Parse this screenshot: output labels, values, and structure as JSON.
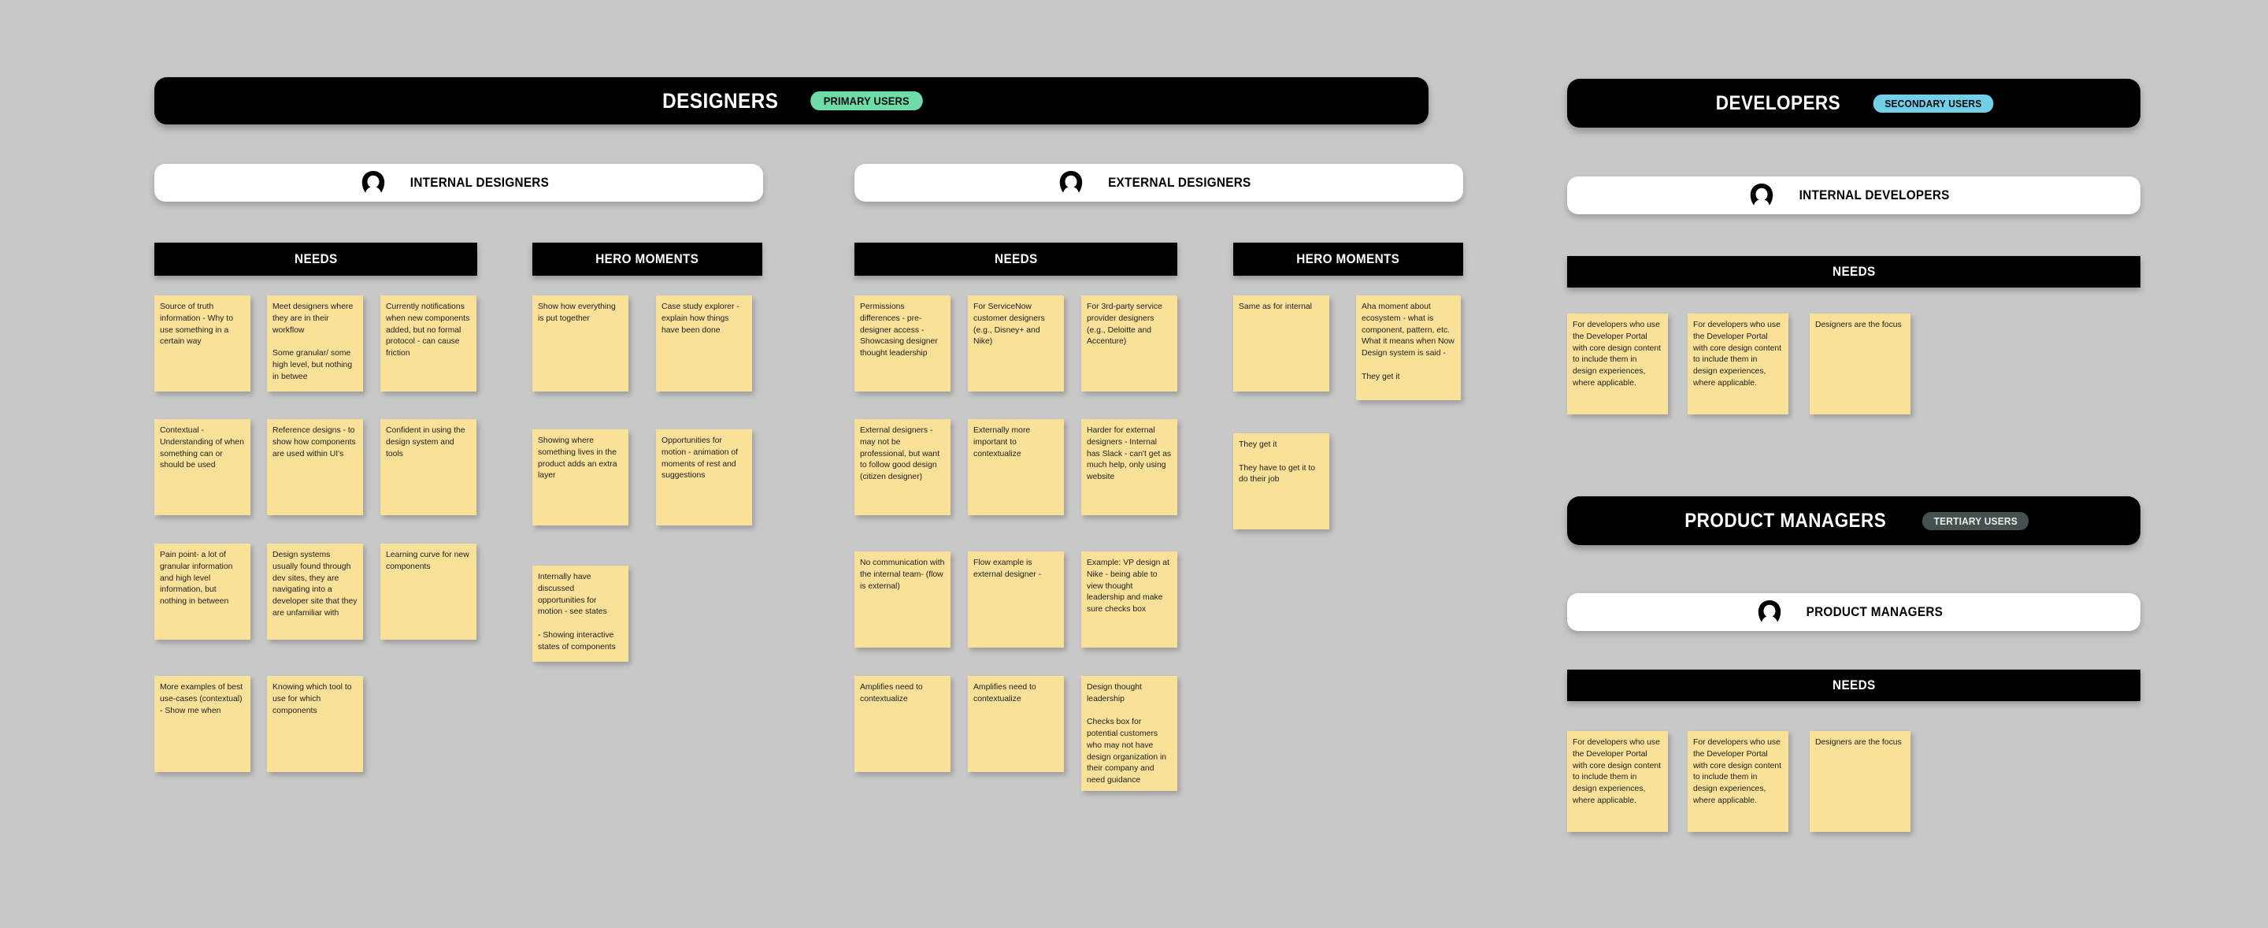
{
  "board": {
    "background_color": "#C8C8C8",
    "note_color": "#FAE199",
    "banner_color": "#000000"
  },
  "groups": [
    {
      "id": "designers",
      "title": "DESIGNERS",
      "badge": "PRIMARY USERS",
      "badge_color": "#6EDCA8"
    },
    {
      "id": "developers",
      "title": "DEVELOPERS",
      "badge": "SECONDARY USERS",
      "badge_color": "#72CFE5"
    },
    {
      "id": "product_managers",
      "title": "PRODUCT MANAGERS",
      "badge": "TERTIARY USERS",
      "badge_color": "#44514E"
    }
  ],
  "personas": {
    "internal_designers": "INTERNAL DESIGNERS",
    "external_designers": "EXTERNAL DESIGNERS",
    "internal_developers": "INTERNAL DEVELOPERS",
    "product_managers": "PRODUCT MANAGERS"
  },
  "column_headers": {
    "needs": "NEEDS",
    "hero_moments": "HERO MOMENTS"
  },
  "internal_designers": {
    "needs": [
      "Source of truth information - Why to use something in a certain way",
      "Meet designers where they are in their workflow\n\nSome granular/ some high level, but nothing in betwee",
      "Currently notifications when new components added, but no formal protocol - can cause friction",
      "Contextual - Understanding of when something can or should be used",
      "Reference designs - to show how components are used within UI's",
      "Confident in using the design system and tools",
      "Pain point- a lot of granular information and high level information, but nothing in between",
      "Design systems usually found through dev sites, they are navigating into a developer site that they are unfamiliar with",
      "Learning curve for new components",
      "More examples of best use-cases (contextual) - Show me when",
      "Knowing which tool to use for which components"
    ],
    "hero_moments": [
      "Show how everything is put together",
      "Case study explorer - explain how things have been done",
      "Showing where something lives in the product adds an extra layer",
      "Opportunities for motion - animation of moments of rest and suggestions",
      "Internally have discussed opportunities for motion - see states\n\n- Showing interactive states of components"
    ]
  },
  "external_designers": {
    "needs": [
      "Permissions differences - pre-designer access - Showcasing designer thought leadership",
      "For ServiceNow customer designers (e.g., Disney+ and Nike)",
      "For 3rd-party service provider designers (e.g., Deloitte and Accenture)",
      "External designers - may not be professional, but want to follow good design (citizen designer)",
      "Externally more important to contextualize",
      "Harder for external designers - Internal has Slack - can't get as much help, only using website",
      "No communication with the internal team- (flow is external)",
      "Flow example is external designer -",
      "Example: VP design at Nike - being able to view thought leadership and make sure checks box",
      "Amplifies need to contextualize",
      "Amplifies need to contextualize",
      "Design thought leadership\n\nChecks box for potential customers who may not have design organization in their company and need guidance"
    ],
    "hero_moments": [
      "Same as for internal",
      "Aha moment about ecosystem - what is component, pattern, etc. What it means when Now Design system is said -\n\nThey get it",
      "They get it\n\nThey have to get it to do their job"
    ]
  },
  "internal_developers": {
    "needs": [
      "For developers who use the Developer Portal with core design content to include them in design experiences, where applicable.",
      "For developers who use the Developer Portal with core design content to include them in design experiences, where applicable.",
      "Designers are the focus"
    ]
  },
  "product_managers_group": {
    "needs": [
      "For developers who use the Developer Portal with core design content to include them in design experiences, where applicable.",
      "For developers who use the Developer Portal with core design content to include them in design experiences, where applicable.",
      "Designers are the focus"
    ]
  }
}
